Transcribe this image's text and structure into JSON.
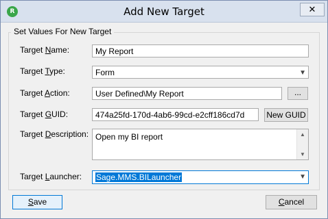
{
  "window": {
    "title": "Add New Target",
    "close_glyph": "✕",
    "icon": "app-logo-icon"
  },
  "group": {
    "title": "Set Values For New Target"
  },
  "fields": {
    "name": {
      "label_pre": "Target ",
      "label_accel": "N",
      "label_post": "ame:",
      "value": "My Report"
    },
    "type": {
      "label_pre": "Target ",
      "label_accel": "T",
      "label_post": "ype:",
      "value": "Form"
    },
    "action": {
      "label_pre": "Target ",
      "label_accel": "A",
      "label_post": "ction:",
      "value": "User Defined\\My Report",
      "browse_label": "..."
    },
    "guid": {
      "label_pre": "Target ",
      "label_accel": "G",
      "label_post": "UID:",
      "value": "474a25fd-170d-4ab6-99cd-e2cff186cd7d",
      "new_label": "New GUID"
    },
    "description": {
      "label_pre": "Target ",
      "label_accel": "D",
      "label_post": "escription:",
      "value": "Open my BI report"
    },
    "launcher": {
      "label_pre": "Target ",
      "label_accel": "L",
      "label_post": "auncher:",
      "value": "Sage.MMS.BILauncher"
    }
  },
  "buttons": {
    "save": {
      "accel": "S",
      "rest": "ave"
    },
    "cancel": {
      "accel": "C",
      "rest": "ancel"
    }
  },
  "colors": {
    "accent": "#0078d7",
    "titlebar": "#d8e1ee"
  }
}
